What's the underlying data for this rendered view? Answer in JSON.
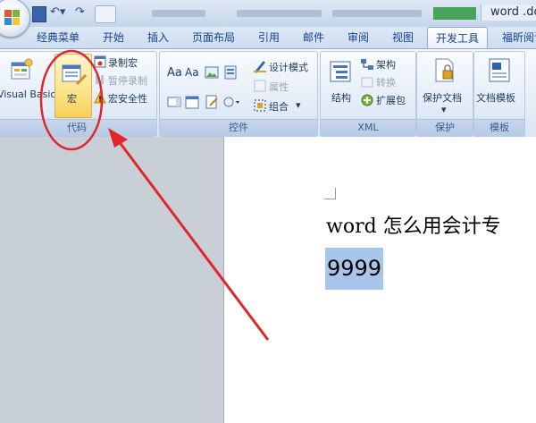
{
  "title": {
    "window_title": "word .do"
  },
  "tabs": [
    "经典菜单",
    "开始",
    "插入",
    "页面布局",
    "引用",
    "邮件",
    "审阅",
    "视图",
    "开发工具",
    "福昕阅读"
  ],
  "active_tab": "开发工具",
  "ribbon": {
    "code": {
      "label": "代码",
      "visual_basic": "Visual Basic",
      "macro": "宏",
      "record_macro": "录制宏",
      "pause_recording": "暂停录制",
      "macro_security": "宏安全性"
    },
    "controls": {
      "label": "控件",
      "aa1": "Aa",
      "aa2": "Aa",
      "design_mode": "设计模式",
      "properties": "属性",
      "group": "组合"
    },
    "xml": {
      "label": "XML",
      "structure": "结构",
      "schema": "架构",
      "transform": "转换",
      "expansion_pack": "扩展包"
    },
    "protect": {
      "label": "保护",
      "protect_document": "保护文档"
    },
    "templates": {
      "label": "模板",
      "document_template": "文档模板"
    }
  },
  "document": {
    "line1": "word 怎么用会计专",
    "line2": "9999"
  },
  "colors": {
    "annotation_red": "#e0262b",
    "selection": "#a8c5eb",
    "macro_highlight": "#fde48a"
  }
}
